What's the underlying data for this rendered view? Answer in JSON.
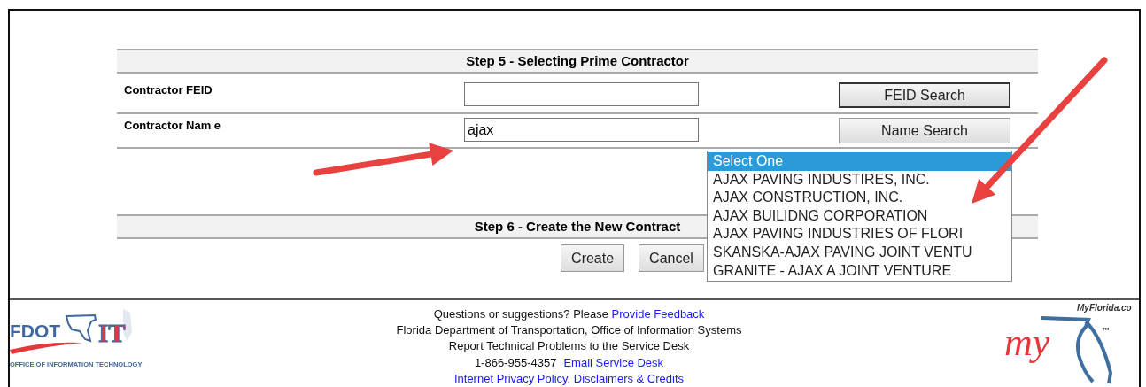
{
  "step5": {
    "title": "Step 5 - Selecting Prime Contractor",
    "fields": [
      {
        "label": "Contractor FEID",
        "button": "FEID Search",
        "focused": true
      },
      {
        "label": "Contractor Nam e",
        "value": "ajax",
        "button": "Name Search",
        "focused": false
      }
    ]
  },
  "results_list": {
    "options": [
      {
        "label": "Select One",
        "selected": true
      },
      {
        "label": "AJAX PAVING INDUSTIRES,  INC.",
        "selected": false
      },
      {
        "label": "AJAX CONSTRUCTION, INC.",
        "selected": false
      },
      {
        "label": "AJAX BUILIDNG CORPORATION",
        "selected": false
      },
      {
        "label": "AJAX PAVING INDUSTRIES OF FLORI",
        "selected": false
      },
      {
        "label": "SKANSKA-AJAX PAVING JOINT VENTU",
        "selected": false
      },
      {
        "label": "GRANITE - AJAX A JOINT VENTURE",
        "selected": false
      }
    ]
  },
  "step6": {
    "title": "Step 6 - Create the New Contract",
    "buttons": [
      "Create",
      "Cancel"
    ]
  },
  "footer": {
    "lines": [
      {
        "parts": [
          {
            "kind": "text",
            "text": "Questions or suggestions? Please "
          },
          {
            "kind": "link",
            "text": "Provide Feedback",
            "underlined": false
          }
        ]
      },
      {
        "parts": [
          {
            "kind": "text",
            "text": "Florida Department of Transportation, Office of Information Systems"
          }
        ]
      },
      {
        "parts": [
          {
            "kind": "text",
            "text": "Report Technical Problems to the Service Desk"
          }
        ]
      },
      {
        "parts": [
          {
            "kind": "phone",
            "text": "1-866-955-4357"
          },
          {
            "kind": "link",
            "text": "Email Service Desk",
            "underlined": true
          }
        ]
      },
      {
        "parts": [
          {
            "kind": "link",
            "text": "Internet Privacy Policy, Disclaimers & Credits",
            "underlined": false
          }
        ]
      }
    ]
  },
  "left_logo": {
    "name": "FDOT",
    "badge": "IT",
    "tagline": "OFFICE OF INFORMATION TECHNOLOGY"
  },
  "right_logo": {
    "site": "MyFlorida.co",
    "mark": "my",
    "trademark": "™"
  }
}
